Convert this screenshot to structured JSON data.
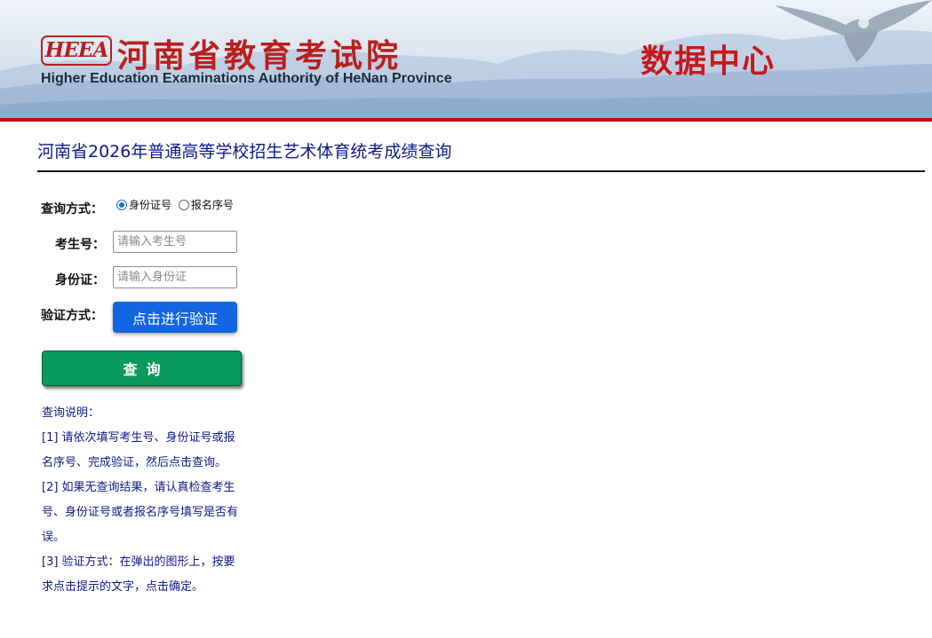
{
  "header": {
    "logo_text": "HEEA",
    "org_name_cn": "河南省教育考试院",
    "org_name_en": "Higher Education Examinations Authority of HeNan Province",
    "center_title": "数据中心"
  },
  "page": {
    "title": "河南省2026年普通高等学校招生艺术体育统考成绩查询"
  },
  "form": {
    "query_mode_label": "查询方式：",
    "query_mode_options": [
      {
        "label": "身份证号",
        "checked": true
      },
      {
        "label": "报名序号",
        "checked": false
      }
    ],
    "exam_no_label": "考生号：",
    "exam_no_placeholder": "请输入考生号",
    "exam_no_value": "",
    "id_label": "身份证：",
    "id_placeholder": "请输入身份证",
    "id_value": "",
    "verify_label": "验证方式：",
    "verify_button": "点击进行验证",
    "query_button": "查询"
  },
  "notes": {
    "heading": "查询说明：",
    "items": [
      "[1] 请依次填写考生号、身份证号或报名序号、完成验证，然后点击查询。",
      "[2] 如果无查询结果，请认真检查考生号、身份证号或者报名序号填写是否有误。",
      "[3] 验证方式：在弹出的图形上，按要求点击提示的文字，点击确定。"
    ]
  },
  "colors": {
    "header_red": "#c8181a",
    "title_blue": "#0c1a8a",
    "verify_blue": "#1266e2",
    "query_green": "#0a9a5e"
  }
}
